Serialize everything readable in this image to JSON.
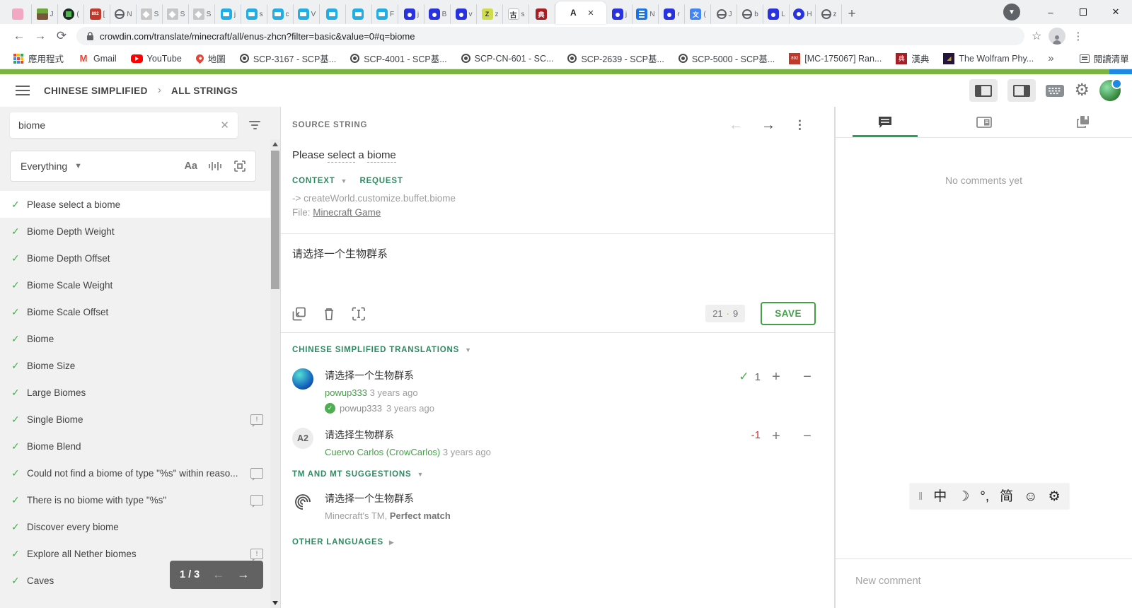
{
  "browser": {
    "tabs": [
      {
        "icon": "anime-icon",
        "hint": ""
      },
      {
        "icon": "minecraft-grass-icon",
        "hint": "J"
      },
      {
        "icon": "creeper-icon",
        "hint": "("
      },
      {
        "icon": "scp-red-icon",
        "hint": "["
      },
      {
        "icon": "globe-icon",
        "hint": "N"
      },
      {
        "icon": "wiki-cube-icon",
        "hint": "S"
      },
      {
        "icon": "wiki-cube-icon",
        "hint": "S"
      },
      {
        "icon": "wiki-cube-icon",
        "hint": "S"
      },
      {
        "icon": "bilibili-icon",
        "hint": "j"
      },
      {
        "icon": "bilibili-icon",
        "hint": "s"
      },
      {
        "icon": "bilibili-icon",
        "hint": "c"
      },
      {
        "icon": "bilibili-icon",
        "hint": "V"
      },
      {
        "icon": "bilibili-icon",
        "hint": ""
      },
      {
        "icon": "bilibili-icon",
        "hint": ""
      },
      {
        "icon": "bilibili-icon",
        "hint": "F"
      },
      {
        "icon": "baidu-paw-icon",
        "hint": "j"
      },
      {
        "icon": "baidu-paw-icon",
        "hint": "B"
      },
      {
        "icon": "baidu-paw-icon",
        "hint": "v"
      },
      {
        "icon": "z-green-icon",
        "hint": "z"
      },
      {
        "icon": "gu-dict-icon",
        "hint": "s"
      },
      {
        "icon": "handian-icon",
        "hint": ""
      },
      {
        "icon": "letter-a-icon",
        "hint": "",
        "active": true
      },
      {
        "icon": "baidu-paw-icon",
        "hint": "j"
      },
      {
        "icon": "blue-doc-icon",
        "hint": "N"
      },
      {
        "icon": "baidu-paw-icon",
        "hint": "r"
      },
      {
        "icon": "translate-icon",
        "hint": "("
      },
      {
        "icon": "globe-icon",
        "hint": "J"
      },
      {
        "icon": "globe-icon",
        "hint": "b"
      },
      {
        "icon": "baidu-paw-icon",
        "hint": "L"
      },
      {
        "icon": "baidu-ball-icon",
        "hint": "H"
      },
      {
        "icon": "globe-icon",
        "hint": "z"
      }
    ],
    "url": "crowdin.com/translate/minecraft/all/enus-zhcn?filter=basic&value=0#q=biome",
    "bookmarks": [
      {
        "label": "應用程式",
        "icon": "apps-grid-icon"
      },
      {
        "label": "Gmail",
        "icon": "gmail-icon"
      },
      {
        "label": "YouTube",
        "icon": "youtube-icon"
      },
      {
        "label": "地圖",
        "icon": "maps-pin-icon"
      },
      {
        "label": "SCP-3167 - SCP基...",
        "icon": "scp-badge-icon"
      },
      {
        "label": "SCP-4001 - SCP基...",
        "icon": "scp-badge-icon"
      },
      {
        "label": "SCP-CN-601 - SC...",
        "icon": "scp-badge-icon"
      },
      {
        "label": "SCP-2639 - SCP基...",
        "icon": "scp-badge-icon"
      },
      {
        "label": "SCP-5000 - SCP基...",
        "icon": "scp-badge-icon"
      },
      {
        "label": "[MC-175067] Ran...",
        "icon": "mojira-icon"
      },
      {
        "label": "漢典",
        "icon": "handian-icon"
      },
      {
        "label": "The Wolfram Phy...",
        "icon": "wolfram-icon"
      }
    ],
    "overflow_glyph": "»",
    "reading_list_label": "閱讀清單"
  },
  "progress": {
    "translated_color": "#7cb342",
    "approved_color": "#1e88e5"
  },
  "header": {
    "breadcrumb_language": "CHINESE SIMPLIFIED",
    "breadcrumb_section": "ALL STRINGS"
  },
  "sidebar": {
    "search_value": "biome",
    "scope_label": "Everything",
    "case_tool_label": "Aa",
    "items": [
      {
        "label": "Please select a biome",
        "selected": true
      },
      {
        "label": "Biome Depth Weight"
      },
      {
        "label": "Biome Depth Offset"
      },
      {
        "label": "Biome Scale Weight"
      },
      {
        "label": "Biome Scale Offset"
      },
      {
        "label": "Biome"
      },
      {
        "label": "Biome Size"
      },
      {
        "label": "Large Biomes"
      },
      {
        "label": "Single Biome",
        "comment_icon": "comment-bang-icon"
      },
      {
        "label": "Biome Blend"
      },
      {
        "label": "Could not find a biome of type \"%s\" within reaso...",
        "comment_icon": "comment-icon"
      },
      {
        "label": "There is no biome with type \"%s\"",
        "comment_icon": "comment-icon"
      },
      {
        "label": "Discover every biome"
      },
      {
        "label": "Explore all Nether biomes",
        "comment_icon": "comment-bang-icon"
      },
      {
        "label": "Caves"
      }
    ],
    "pagination": {
      "label": "1 / 3"
    }
  },
  "main": {
    "source_label": "SOURCE STRING",
    "source_parts": {
      "pre": "Please ",
      "term1": "select",
      "mid": " a ",
      "term2": "biome"
    },
    "context_label": "CONTEXT",
    "request_label": "REQUEST",
    "context_path": "-> createWorld.customize.buffet.biome",
    "file_label": "File:",
    "file_link": "Minecraft Game",
    "translation_value": "请选择一个生物群系",
    "counter": {
      "source_chars": "21",
      "dot": "·",
      "translation_chars": "9"
    },
    "save_label": "SAVE",
    "translations_header": "CHINESE SIMPLIFIED TRANSLATIONS",
    "translations": [
      {
        "text": "请选择一个生物群系",
        "author": "powup333",
        "time": "3 years ago",
        "approved_by": "powup333",
        "approved_time": "3 years ago",
        "rating": "1"
      },
      {
        "avatar_text": "A2",
        "text": "请选择生物群系",
        "author": "Cuervo Carlos (CrowCarlos)",
        "time": "3 years ago",
        "rating": "-1"
      }
    ],
    "tm_header": "TM AND MT SUGGESTIONS",
    "tm": {
      "text": "请选择一个生物群系",
      "source": "Minecraft's TM,",
      "match": "Perfect match"
    },
    "other_header": "OTHER LANGUAGES"
  },
  "rightpanel": {
    "empty_text": "No comments yet",
    "new_comment_placeholder": "New comment",
    "ime_items": [
      "中",
      "☽",
      "°,",
      "简",
      "☺",
      "⚙"
    ]
  },
  "colors": {
    "accent_green": "#43a047",
    "section_green": "#2e8b5f",
    "tab_underline_green": "#2aa05c",
    "negative_red": "#d32f2f",
    "progress_green": "#7cb342",
    "progress_blue": "#1e88e5"
  }
}
